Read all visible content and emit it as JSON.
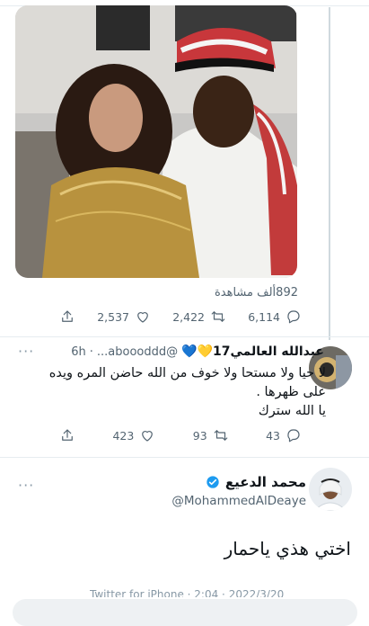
{
  "main_tweet": {
    "views": "892ألف مشاهدة",
    "stats": {
      "replies": "6,114",
      "retweets": "2,422",
      "likes": "2,537"
    }
  },
  "reply": {
    "display_name": "عبدالله العالمي17💛💙",
    "handle": "@aboooddd...",
    "time": "6h",
    "text_line1": "لا حيا ولا مستحا ولا خوف من الله حاضن المره ويده على ظهرها .",
    "text_line2": "يا الله سترك",
    "stats": {
      "replies": "43",
      "retweets": "93",
      "likes": "423"
    }
  },
  "tweet": {
    "display_name": "محمد الدعيع",
    "handle": "@MohammedAlDeaye",
    "text": "اختي هذي ياحمار",
    "meta": "Twitter for iPhone · 2:04 · 2022/3/20"
  },
  "colors": {
    "accent": "#1d9bf0",
    "secondary": "#536471",
    "divider": "#e6ecf0"
  }
}
